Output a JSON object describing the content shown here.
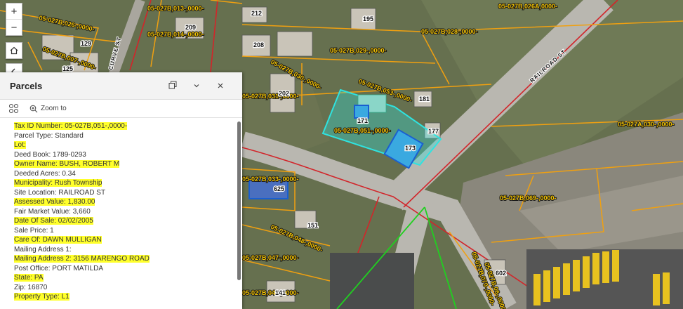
{
  "map": {
    "parcel_labels": [
      "05-027B,026-,0000-",
      "05-027B,014-,0000-",
      "05-027B,007-,0000-",
      "05-027B,028-,0000-",
      "05-027B,026A,0000-",
      "05-027B,029-,0000-",
      "05-027B,030-,0000-",
      "05-027B,053-,0000-",
      "05-027B,031-,0000-",
      "05-027B,051-,0000-",
      "05-027A,030-,0000-",
      "05-027B,033-,0000-",
      "05-027B,048-,0000-",
      "05-027B,047-,0000-",
      "05-027B,046-,0000-",
      "05-027B,069-,0000-",
      "05-027B,070-,0000-",
      "05-027B,06-,0000-",
      "05-027B,013-,0000-"
    ],
    "address_labels": [
      "212",
      "195",
      "209",
      "129",
      "208",
      "125",
      "202",
      "181",
      "171",
      "177",
      "173",
      "625",
      "151",
      "141",
      "602"
    ],
    "road_labels": [
      "RAILROAD ST",
      "CURVE ST"
    ],
    "selected_parcel_color": "#2fe3e0"
  },
  "controls": {
    "zoom_in": "+",
    "zoom_out": "−",
    "home": "home-icon",
    "back": "back-icon"
  },
  "panel": {
    "title": "Parcels",
    "zoom_to": "Zoom to",
    "highlight_color": "#ffff2b",
    "attributes": [
      {
        "label": "Tax ID Number",
        "value": "05-027B,051-,0000-",
        "highlight": true
      },
      {
        "label": "Parcel Type",
        "value": "Standard",
        "highlight": false
      },
      {
        "label": "Lot",
        "value": "",
        "highlight": true
      },
      {
        "label": "Deed Book",
        "value": "1789-0293",
        "highlight": false
      },
      {
        "label": "Owner Name",
        "value": "BUSH, ROBERT M",
        "highlight": true
      },
      {
        "label": "Deeded Acres",
        "value": "0.34",
        "highlight": false
      },
      {
        "label": "Municipality",
        "value": "Rush Township",
        "highlight": true
      },
      {
        "label": "Site Location",
        "value": "RAILROAD ST",
        "highlight": false
      },
      {
        "label": "Assessed Value",
        "value": "1,830.00",
        "highlight": true
      },
      {
        "label": "Fair Market Value",
        "value": "3,660",
        "highlight": false
      },
      {
        "label": "Date Of Sale",
        "value": "02/02/2005",
        "highlight": true
      },
      {
        "label": "Sale Price",
        "value": "1",
        "highlight": false
      },
      {
        "label": "Care Of",
        "value": "DAWN MULLIGAN",
        "highlight": true
      },
      {
        "label": "Mailing Address 1",
        "value": "",
        "highlight": false
      },
      {
        "label": "Mailing Address 2",
        "value": "3156 MARENGO ROAD",
        "highlight": true
      },
      {
        "label": "Post Office",
        "value": "PORT MATILDA",
        "highlight": false
      },
      {
        "label": "State",
        "value": "PA",
        "highlight": true
      },
      {
        "label": "Zip",
        "value": "16870",
        "highlight": false
      },
      {
        "label": "Property Type",
        "value": "L1",
        "highlight": true
      }
    ]
  }
}
